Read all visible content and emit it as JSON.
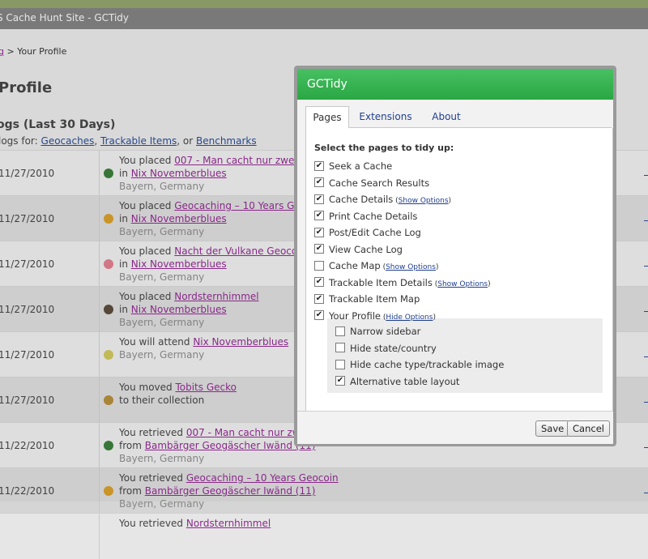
{
  "window": {
    "title": "S Cache Hunt Site - GCTidy"
  },
  "breadcrumb": {
    "link": "g",
    "separator": " > ",
    "current": "Your Profile"
  },
  "page": {
    "title": "Profile",
    "logs_heading": "ogs (Last 30 Days)",
    "view_logs": {
      "prefix": "logs for:",
      "geocaches": "Geocaches",
      "comma": ",",
      "trackables": "Trackable Items",
      "or": ", or",
      "benchmarks": "Benchmarks"
    }
  },
  "logs": [
    {
      "date": "11/27/2010",
      "icon": "traditional-cache-icon",
      "icon_color": "#3a7a3a",
      "verb": "You placed",
      "link": "007 - Man cacht nur zweimal",
      "prep": "in",
      "link2": "Nix Novemberblues",
      "loc": "Bayern, Germany"
    },
    {
      "date": "11/27/2010",
      "icon": "geocoin-icon",
      "icon_color": "#d09a2a",
      "verb": "You placed",
      "link": "Geocaching – 10 Years Geocoin",
      "prep": "in",
      "link2": "Nix Novemberblues",
      "loc": "Bayern, Germany"
    },
    {
      "date": "11/27/2010",
      "icon": "flower-icon",
      "icon_color": "#d87a8a",
      "verb": "You placed",
      "link": "Nacht der Vulkane Geocoin",
      "prep": "in",
      "link2": "Nix Novemberblues",
      "loc": "Bayern, Germany"
    },
    {
      "date": "11/27/2010",
      "icon": "bug-icon",
      "icon_color": "#5a4a3a",
      "verb": "You placed",
      "link": "Nordsternhimmel",
      "prep": "in",
      "link2": "Nix Novemberblues",
      "loc": "Bayern, Germany"
    },
    {
      "date": "11/27/2010",
      "icon": "event-cache-icon",
      "icon_color": "#c8c05a",
      "verb": "You will attend",
      "link": "Nix Novemberblues",
      "prep": "",
      "link2": "",
      "loc": "Bayern, Germany"
    },
    {
      "date": "11/27/2010",
      "icon": "gecko-icon",
      "icon_color": "#b08a3a",
      "verb": "You moved",
      "link": "Tobits Gecko",
      "prep": "to their collection",
      "link2": "",
      "loc": ""
    },
    {
      "date": "11/22/2010",
      "icon": "traditional-cache-icon",
      "icon_color": "#3a7a3a",
      "verb": "You retrieved",
      "link": "007 - Man cacht nur zweimal",
      "prep": "from",
      "link2": "Bambärger Geogäscher Iwänd (11)",
      "loc": "Bayern, Germany"
    },
    {
      "date": "11/22/2010",
      "icon": "geocoin-icon",
      "icon_color": "#d09a2a",
      "verb": "You retrieved",
      "link": "Geocaching – 10 Years Geocoin",
      "prep": "from",
      "link2": "Bambärger Geogäscher Iwänd (11)",
      "loc": "Bayern, Germany"
    },
    {
      "date": "",
      "icon": "",
      "icon_color": "",
      "verb": "You retrieved",
      "link": "Nordsternhimmel",
      "prep": "",
      "link2": "",
      "loc": ""
    }
  ],
  "dialog": {
    "title": "GCTidy",
    "tabs": [
      "Pages",
      "Extensions",
      "About"
    ],
    "section_label": "Select the pages to tidy up:",
    "options": [
      {
        "label": "Seek a Cache",
        "checked": true,
        "link": ""
      },
      {
        "label": "Cache Search Results",
        "checked": true,
        "link": ""
      },
      {
        "label": "Cache Details",
        "checked": true,
        "link": "Show Options"
      },
      {
        "label": "Print Cache Details",
        "checked": true,
        "link": ""
      },
      {
        "label": "Post/Edit Cache Log",
        "checked": true,
        "link": ""
      },
      {
        "label": "View Cache Log",
        "checked": true,
        "link": ""
      },
      {
        "label": "Cache Map",
        "checked": false,
        "link": "Show Options"
      },
      {
        "label": "Trackable Item Details",
        "checked": true,
        "link": "Show Options"
      },
      {
        "label": "Trackable Item Map",
        "checked": true,
        "link": ""
      },
      {
        "label": "Your Profile",
        "checked": true,
        "link": "Hide Options"
      }
    ],
    "profile_options": [
      {
        "label": "Narrow sidebar",
        "checked": false
      },
      {
        "label": "Hide state/country",
        "checked": false
      },
      {
        "label": "Hide cache type/trackable image",
        "checked": false
      },
      {
        "label": "Alternative table layout",
        "checked": true
      }
    ],
    "save": "Save",
    "cancel": "Cancel"
  },
  "colors": {
    "accent": "#2aa744",
    "link": "#8e2a8e"
  }
}
